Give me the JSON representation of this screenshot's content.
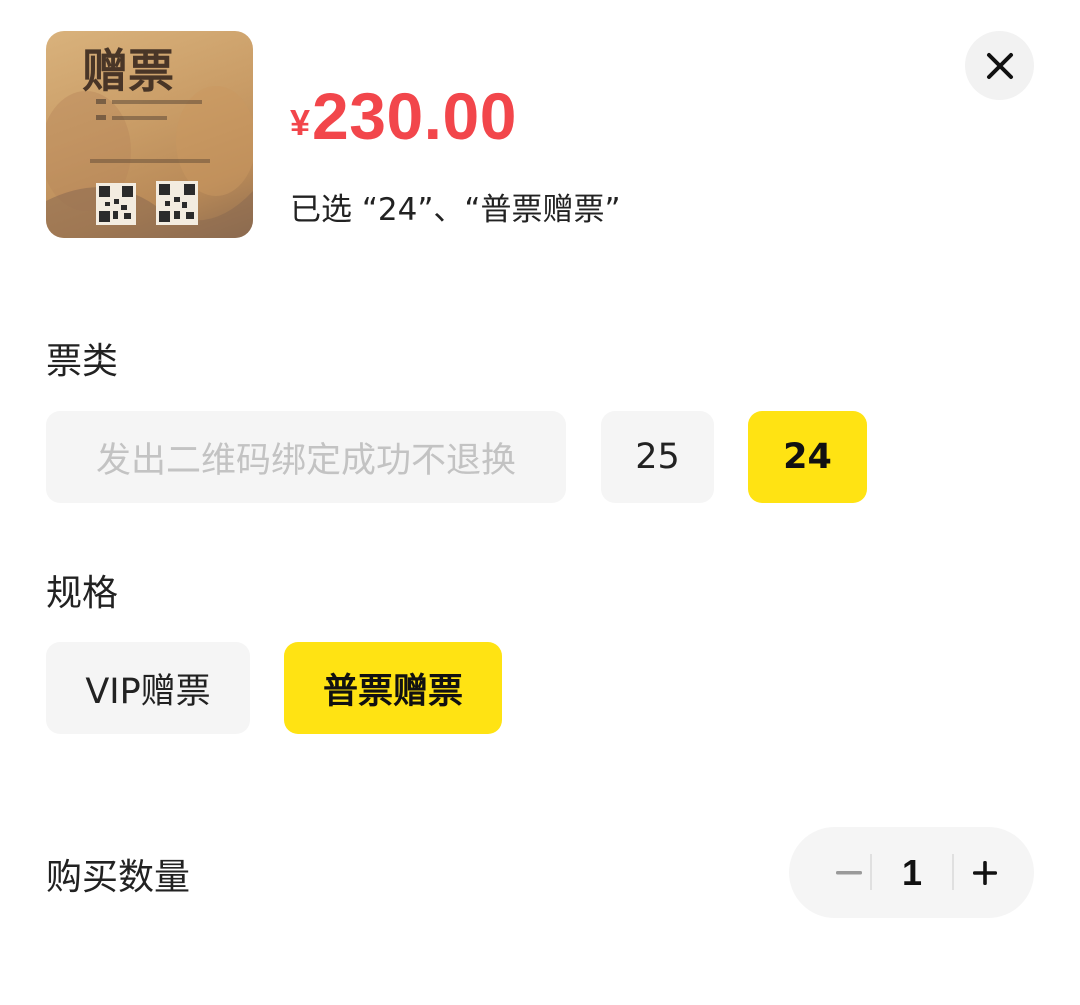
{
  "product": {
    "image_icon": "ticket-photo",
    "image_text": "赠票",
    "price_currency": "¥",
    "price_amount": "230.00",
    "selected_text": "已选 “24”、“普票赠票”"
  },
  "close": {
    "icon": "close-icon"
  },
  "ticket_type": {
    "title": "票类",
    "options": [
      {
        "label": "发出二维码绑定成功不退换",
        "state": "disabled"
      },
      {
        "label": "25",
        "state": "normal"
      },
      {
        "label": "24",
        "state": "selected"
      }
    ]
  },
  "spec": {
    "title": "规格",
    "options": [
      {
        "label": "VIP赠票",
        "state": "normal"
      },
      {
        "label": "普票赠票",
        "state": "selected"
      }
    ]
  },
  "quantity": {
    "label": "购买数量",
    "value": "1",
    "minus_icon": "minus-icon",
    "plus_icon": "plus-icon"
  },
  "colors": {
    "price": "#f2464b",
    "accent": "#ffe313",
    "option_bg": "#f5f5f5"
  }
}
